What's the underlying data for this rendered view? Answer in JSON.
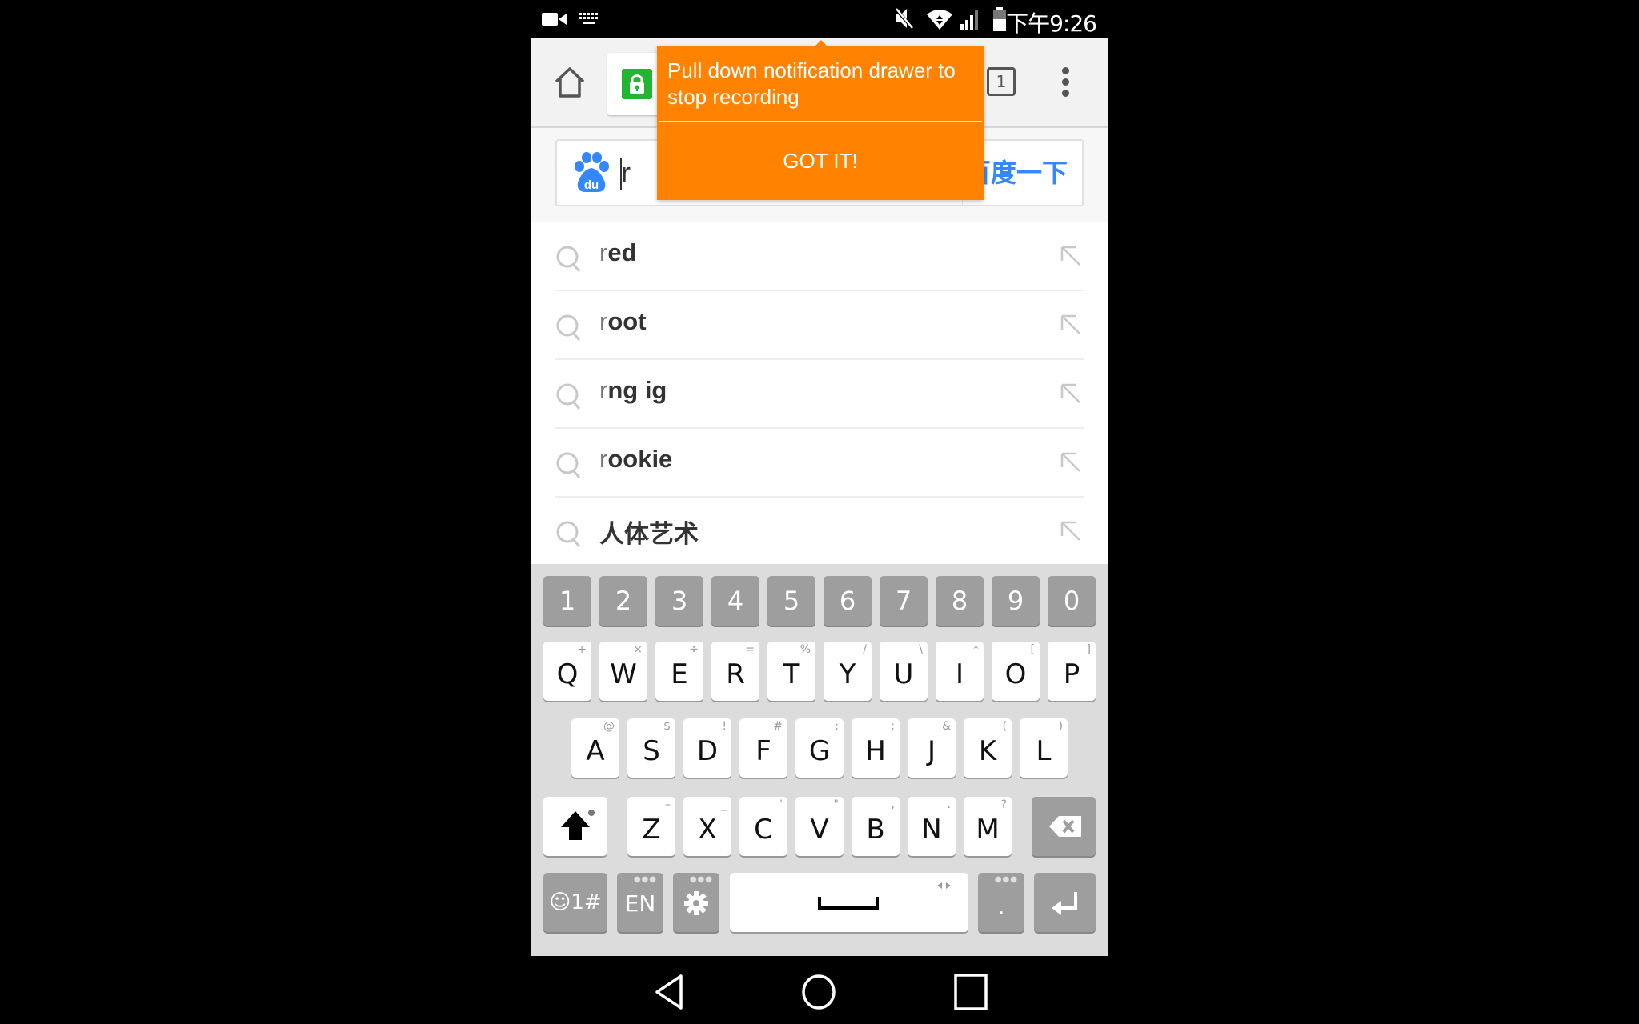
{
  "status_bar": {
    "left_icons": [
      "video-record-icon",
      "keyboard-icon"
    ],
    "right_icons": [
      "mute-icon",
      "wifi-icon",
      "signal-icon",
      "battery-icon"
    ],
    "time": "下午9:26"
  },
  "toolbar": {
    "home_icon": "home-icon",
    "lock_icon": "lock-icon",
    "tab_count": "1",
    "menu_icon": "more-vert-icon"
  },
  "popup": {
    "message": "Pull down notification drawer to stop recording",
    "button": "GOT IT!",
    "color": "#ff8200"
  },
  "search": {
    "logo": "baidu-paw-icon",
    "value": "r",
    "submit": "百度一下",
    "accent": "#3388ff"
  },
  "suggestions": [
    {
      "typed": "r",
      "rest": "ed"
    },
    {
      "typed": "r",
      "rest": "oot"
    },
    {
      "typed": "r",
      "rest": "ng ig"
    },
    {
      "typed": "r",
      "rest": "ookie"
    },
    {
      "typed": "",
      "rest": "人体艺术"
    }
  ],
  "keyboard": {
    "numbers": [
      "1",
      "2",
      "3",
      "4",
      "5",
      "6",
      "7",
      "8",
      "9",
      "0"
    ],
    "row1": [
      {
        "key": "Q",
        "hint": "+"
      },
      {
        "key": "W",
        "hint": "×"
      },
      {
        "key": "E",
        "hint": "÷"
      },
      {
        "key": "R",
        "hint": "="
      },
      {
        "key": "T",
        "hint": "%"
      },
      {
        "key": "Y",
        "hint": "/"
      },
      {
        "key": "U",
        "hint": "\\"
      },
      {
        "key": "I",
        "hint": "*"
      },
      {
        "key": "O",
        "hint": "["
      },
      {
        "key": "P",
        "hint": "]"
      }
    ],
    "row2": [
      {
        "key": "A",
        "hint": "@"
      },
      {
        "key": "S",
        "hint": "$"
      },
      {
        "key": "D",
        "hint": "!"
      },
      {
        "key": "F",
        "hint": "#"
      },
      {
        "key": "G",
        "hint": ":"
      },
      {
        "key": "H",
        "hint": ";"
      },
      {
        "key": "J",
        "hint": "&"
      },
      {
        "key": "K",
        "hint": "("
      },
      {
        "key": "L",
        "hint": ")"
      }
    ],
    "row3": [
      {
        "key": "Z",
        "hint": "–"
      },
      {
        "key": "X",
        "hint": "_"
      },
      {
        "key": "C",
        "hint": "'"
      },
      {
        "key": "V",
        "hint": "\""
      },
      {
        "key": "B",
        "hint": ","
      },
      {
        "key": "N",
        "hint": "."
      },
      {
        "key": "M",
        "hint": "?"
      }
    ],
    "symbols_label": "☺1#",
    "lang_label": "EN",
    "period_label": ".",
    "settings_icon": "gear-icon",
    "shift_icon": "shift-icon",
    "backspace_icon": "backspace-icon",
    "enter_icon": "enter-icon",
    "space_icon": "space-icon"
  },
  "nav": {
    "back": "back-icon",
    "home": "home-circle-icon",
    "recents": "recents-icon"
  }
}
